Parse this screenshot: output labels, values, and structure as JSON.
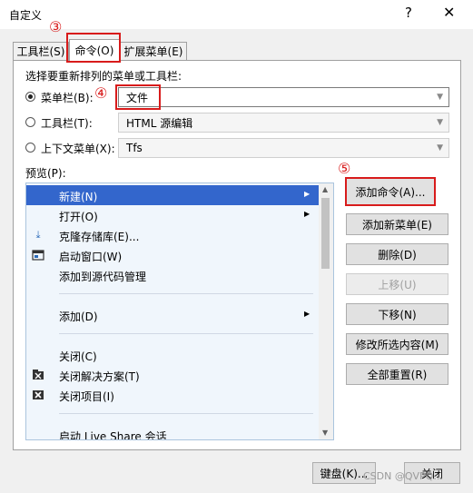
{
  "window": {
    "title": "自定义",
    "help_glyph": "?",
    "close_glyph": "✕"
  },
  "tabs": [
    {
      "label": "工具栏(S)"
    },
    {
      "label": "命令(O)"
    },
    {
      "label": "扩展菜单(E)"
    }
  ],
  "panel": {
    "choose_label": "选择要重新排列的菜单或工具栏:",
    "menubar": {
      "label": "菜单栏(B):",
      "value": "文件"
    },
    "toolbar": {
      "label": "工具栏(T):",
      "value": "HTML 源编辑"
    },
    "context": {
      "label": "上下文菜单(X):",
      "value": "Tfs"
    },
    "preview_label": "预览(P):"
  },
  "preview_items": [
    {
      "label": "新建(N)",
      "icon": "",
      "submenu": true
    },
    {
      "label": "打开(O)",
      "icon": "",
      "submenu": true
    },
    {
      "label": "克隆存储库(E)...",
      "icon": "clone-icon",
      "submenu": false
    },
    {
      "label": "启动窗口(W)",
      "icon": "start-window-icon",
      "submenu": false
    },
    {
      "label": "添加到源代码管理",
      "icon": "",
      "submenu": false
    },
    {
      "label": "添加(D)",
      "icon": "",
      "submenu": true
    },
    {
      "label": "关闭(C)",
      "icon": "",
      "submenu": false
    },
    {
      "label": "关闭解决方案(T)",
      "icon": "close-solution-icon",
      "submenu": false
    },
    {
      "label": "关闭项目(I)",
      "icon": "close-project-icon",
      "submenu": false
    },
    {
      "label": "启动 Live Share 会话",
      "icon": "",
      "submenu": false
    }
  ],
  "buttons": {
    "add_command": "添加命令(A)...",
    "add_menu": "添加新菜单(E)",
    "delete": "删除(D)",
    "move_up": "上移(U)",
    "move_down": "下移(N)",
    "modify": "修改所选内容(M)",
    "reset_all": "全部重置(R)",
    "keyboard": "键盘(K)...",
    "close": "关闭"
  },
  "annotations": {
    "three": "③",
    "four": "④",
    "five": "⑤"
  },
  "watermark": "CSDN @QVPQ...",
  "colors": {
    "selection": "#3366cc",
    "annotation_red": "#d81b1b"
  }
}
